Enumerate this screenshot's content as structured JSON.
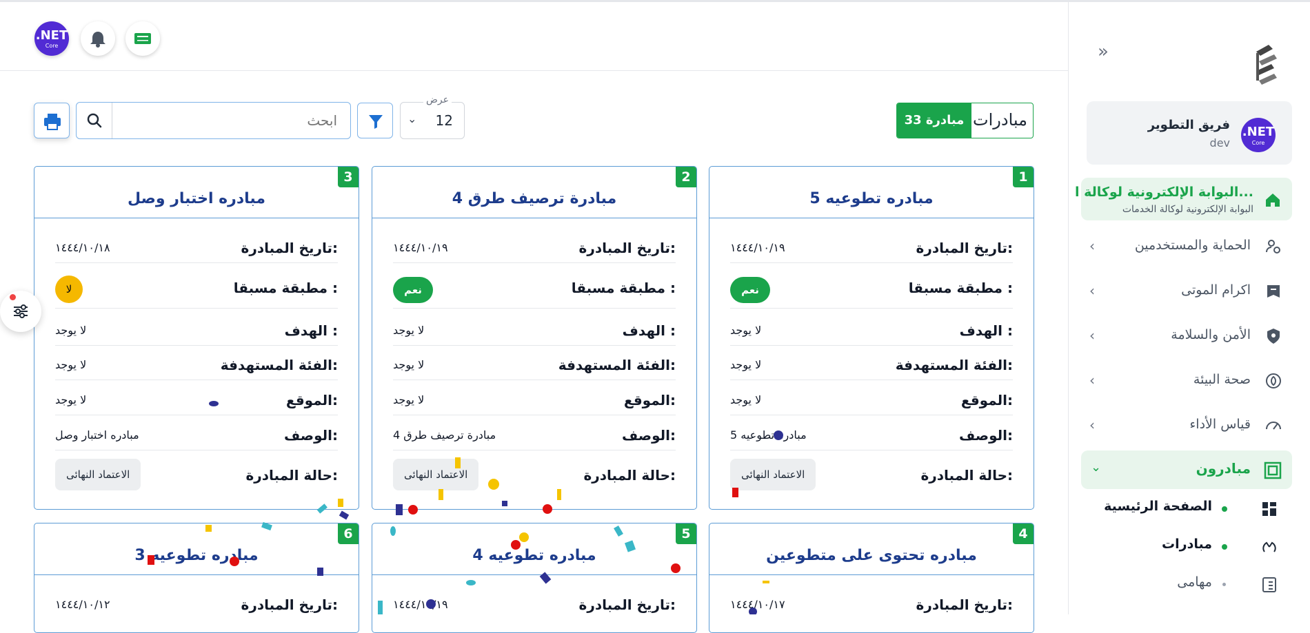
{
  "header": {
    "avatar_big": ".NET",
    "avatar_small": "Core"
  },
  "sidebar": {
    "user": {
      "name": "فريق التطوير",
      "role": "dev",
      "avatar_big": ".NET",
      "avatar_small": "Core"
    },
    "active_item": {
      "title": "البوابة الإلكترونية لوكالة ا...",
      "subtitle": "البوابة الإلكترونية لوكالة الخدمات"
    },
    "items": [
      {
        "label": "الحماية والمستخدمين",
        "icon": "user-gear-icon"
      },
      {
        "label": "اكرام الموتى",
        "icon": "archive-icon"
      },
      {
        "label": "الأمن والسلامة",
        "icon": "shield-icon"
      },
      {
        "label": "صحة البيئة",
        "icon": "leaf-icon"
      },
      {
        "label": "قياس الأداء",
        "icon": "gauge-icon"
      }
    ],
    "open_section": {
      "label": "مبادرون",
      "icon": "frame-icon"
    },
    "sub_items": [
      {
        "label": "الصفحة الرئيسية",
        "icon": "grid-icon"
      },
      {
        "label": "مبادرات",
        "icon": "hands-icon"
      },
      {
        "label": "مهامى",
        "icon": "checklist-icon"
      }
    ]
  },
  "toolbar": {
    "title": "مبادرات",
    "count": "33 مبادرة",
    "search_placeholder": "ابحث",
    "per_page_label": "عرض",
    "per_page_value": "12"
  },
  "labels": {
    "date": "تاريخ المبادرة:",
    "applied": "مطبقة مسبقا :",
    "goal": "الهدف :",
    "target": "الفئة المستهدفة:",
    "location": "الموقع:",
    "description": "الوصف:",
    "status": "حالة المبادرة:"
  },
  "cards": [
    {
      "num": "1",
      "title": "مبادره تطوعيه 5",
      "date": "١٤٤٤/١٠/١٩",
      "applied": "نعم",
      "goal": "لا يوجد",
      "target": "لا يوجد",
      "location": "لا يوجد",
      "description": "مبادره تطوعيه 5",
      "status": "الاعتماد النهائى"
    },
    {
      "num": "2",
      "title": "مبادرة ترصيف طرق 4",
      "date": "١٤٤٤/١٠/١٩",
      "applied": "نعم",
      "goal": "لا يوجد",
      "target": "لا يوجد",
      "location": "لا يوجد",
      "description": "مبادرة ترصيف طرق 4",
      "status": "الاعتماد النهائى"
    },
    {
      "num": "3",
      "title": "مبادره اختبار وصل",
      "date": "١٤٤٤/١٠/١٨",
      "applied": "لا",
      "goal": "لا يوجد",
      "target": "لا يوجد",
      "location": "لا يوجد",
      "description": "مبادره اختبار وصل",
      "status": "الاعتماد النهائى"
    },
    {
      "num": "4",
      "title": "مبادره تحتوى على متطوعين",
      "date": "١٤٤٤/١٠/١٧"
    },
    {
      "num": "5",
      "title": "مبادره تطوعيه 4",
      "date": "١٤٤٤/١٠/١٩"
    },
    {
      "num": "6",
      "title": "مبادره تطوعيه 3",
      "date": "١٤٤٤/١٠/١٢"
    }
  ],
  "colors": {
    "brand_green": "#1aa44b",
    "card_border": "#5b9bd5",
    "title_blue": "#1d3c8c",
    "badge_yellow": "#f5b800",
    "dotnet_purple": "#512bd4"
  }
}
